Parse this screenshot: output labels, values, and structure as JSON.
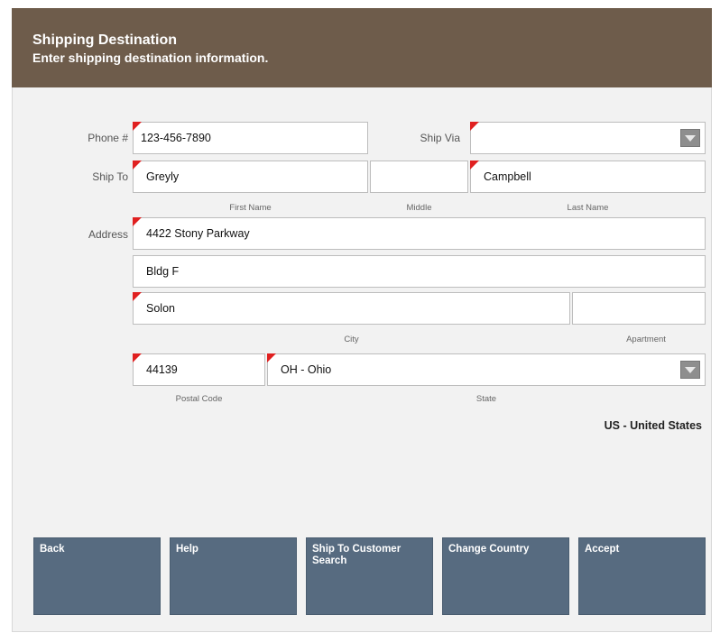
{
  "header": {
    "title": "Shipping Destination",
    "subtitle": "Enter shipping destination information."
  },
  "labels": {
    "phone": "Phone #",
    "ship_via": "Ship Via",
    "ship_to": "Ship To",
    "address": "Address"
  },
  "fields": {
    "phone": "123-456-7890",
    "ship_via": "",
    "first_name": "Greyly",
    "middle": "",
    "last_name": "Campbell",
    "address1": "4422 Stony Parkway",
    "address2": "Bldg F",
    "city": "Solon",
    "apartment": "",
    "postal_code": "44139",
    "state": "OH - Ohio"
  },
  "sublabels": {
    "first_name": "First Name",
    "middle": "Middle",
    "last_name": "Last Name",
    "city": "City",
    "apartment": "Apartment",
    "postal_code": "Postal Code",
    "state": "State"
  },
  "country": "US - United States",
  "buttons": {
    "back": "Back",
    "help": "Help",
    "ship_to_customer_search": "Ship To Customer Search",
    "change_country": "Change Country",
    "accept": "Accept"
  },
  "colors": {
    "header": "#6e5c4b",
    "button": "#576b80",
    "required_marker": "#e02020"
  }
}
